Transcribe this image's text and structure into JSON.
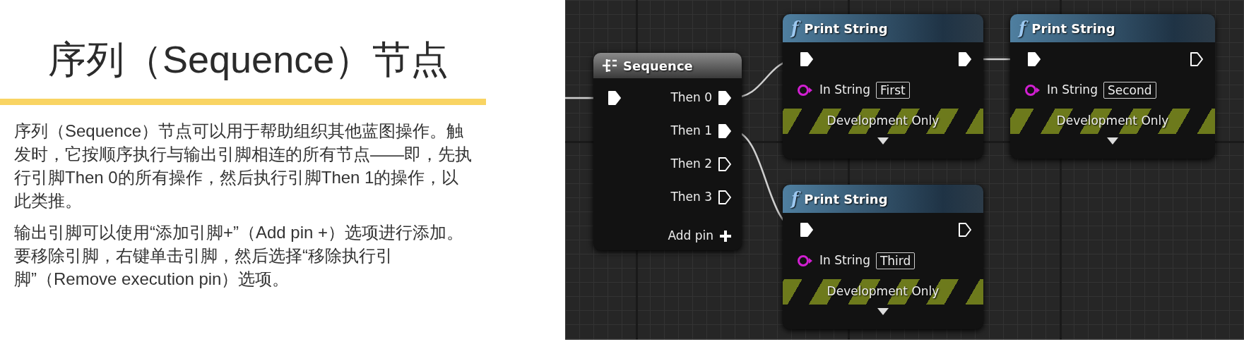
{
  "slide": {
    "title": "序列（Sequence）节点",
    "paragraphs": [
      "序列（Sequence）节点可以用于帮助组织其他蓝图操作。触发时，它按顺序执行与输出引脚相连的所有节点——即，先执行引脚Then 0的所有操作，然后执行引脚Then 1的操作，以此类推。",
      "输出引脚可以使用“添加引脚+”（Add pin +）选项进行添加。要移除引脚，右键单击引脚，然后选择“移除执行引脚”（Remove execution pin）选项。"
    ]
  },
  "graph": {
    "nodes": [
      {
        "kind": "sequence",
        "title": "Sequence",
        "exec_in_connected": true,
        "outputs": [
          {
            "label": "Then 0",
            "connected": true
          },
          {
            "label": "Then 1",
            "connected": true
          },
          {
            "label": "Then 2",
            "connected": false
          },
          {
            "label": "Then 3",
            "connected": false
          }
        ],
        "add_pin": "Add pin"
      },
      {
        "kind": "print_string",
        "icon_glyph": "f",
        "title": "Print String",
        "exec_in_connected": true,
        "exec_out_connected": true,
        "input_label": "In String",
        "input_value": "First",
        "banner": "Development Only"
      },
      {
        "kind": "print_string",
        "icon_glyph": "f",
        "title": "Print String",
        "exec_in_connected": true,
        "exec_out_connected": false,
        "input_label": "In String",
        "input_value": "Second",
        "banner": "Development Only"
      },
      {
        "kind": "print_string",
        "icon_glyph": "f",
        "title": "Print String",
        "exec_in_connected": true,
        "exec_out_connected": false,
        "input_label": "In String",
        "input_value": "Third",
        "banner": "Development Only"
      }
    ]
  }
}
